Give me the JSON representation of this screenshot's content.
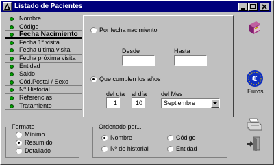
{
  "window": {
    "title": "Listado de Pacientes"
  },
  "title_buttons": [
    "minimize-button",
    "maximize-button",
    "close-button"
  ],
  "fields": [
    {
      "label": "Nombre"
    },
    {
      "label": "Código"
    },
    {
      "label": "Fecha Nacimiento",
      "active": true
    },
    {
      "label": "Fecha 1ª visita"
    },
    {
      "label": "Fecha última visita"
    },
    {
      "label": "Fecha próxima visita"
    },
    {
      "label": "Entidad"
    },
    {
      "label": "Saldo"
    },
    {
      "label": "Cód.Postal / Sexo"
    },
    {
      "label": "Nº Historial"
    },
    {
      "label": "Referencias"
    },
    {
      "label": "Tratamiento"
    }
  ],
  "filter": {
    "por_fecha_label": "Por fecha nacimiento",
    "desde_label": "Desde",
    "hasta_label": "Hasta",
    "desde_value": "",
    "hasta_value": "",
    "cumplen_label": "Que cumplen los años",
    "del_dia_label": "del día",
    "al_dia_label": "al día",
    "del_mes_label": "del Mes",
    "del_dia_value": "1",
    "al_dia_value": "10",
    "mes_value": "Septiembre"
  },
  "formato": {
    "title": "Formato",
    "options": [
      "Mínimo",
      "Resumido",
      "Detallado"
    ],
    "selected": "Resumido"
  },
  "ordenado": {
    "title": "Ordenado por...",
    "options": [
      "Nombre",
      "Código",
      "Nº de historial",
      "Entidad"
    ],
    "selected": "Nombre"
  },
  "toolbar": {
    "euros_label": "Euros"
  }
}
